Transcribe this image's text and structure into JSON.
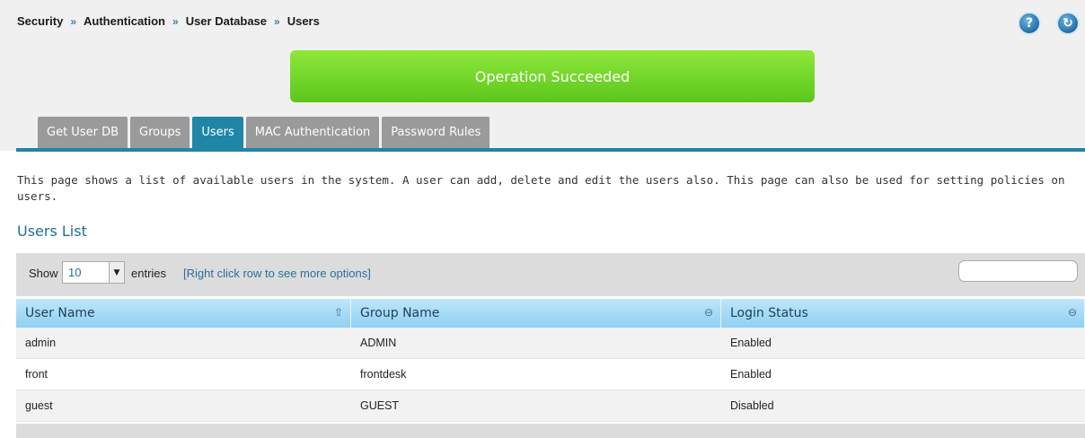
{
  "breadcrumb": [
    "Security",
    "Authentication",
    "User Database",
    "Users"
  ],
  "breadcrumb_separator": "»",
  "header_icons": {
    "help": "?",
    "refresh": "↻"
  },
  "banner": {
    "text": "Operation Succeeded",
    "color": "#6fd22a"
  },
  "tabs": [
    {
      "label": "Get User DB",
      "active": false
    },
    {
      "label": "Groups",
      "active": false
    },
    {
      "label": "Users",
      "active": true
    },
    {
      "label": "MAC Authentication",
      "active": false
    },
    {
      "label": "Password Rules",
      "active": false
    }
  ],
  "description": "This page shows a list of available users in the system. A user can add, delete and edit the users also. This page can also be used for setting policies on users.",
  "section_title": "Users List",
  "toolbar": {
    "show_label": "Show",
    "entries_value": "10",
    "entries_label": "entries",
    "hint": "[Right click row to see more options]",
    "search_value": ""
  },
  "table": {
    "headers": [
      "User Name",
      "Group Name",
      "Login Status"
    ],
    "rows": [
      [
        "admin",
        "ADMIN",
        "Enabled"
      ],
      [
        "front",
        "frontdesk",
        "Enabled"
      ],
      [
        "guest",
        "GUEST",
        "Disabled"
      ]
    ]
  },
  "colors": {
    "accent": "#1f86a8",
    "tab_inactive": "#9a9a9a",
    "success": "#6fd22a"
  }
}
